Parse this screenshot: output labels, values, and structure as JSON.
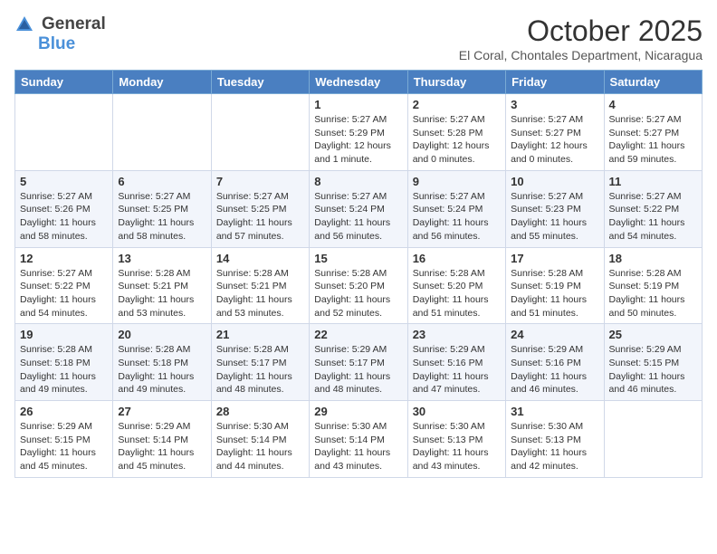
{
  "header": {
    "logo_general": "General",
    "logo_blue": "Blue",
    "month_year": "October 2025",
    "location": "El Coral, Chontales Department, Nicaragua"
  },
  "weekdays": [
    "Sunday",
    "Monday",
    "Tuesday",
    "Wednesday",
    "Thursday",
    "Friday",
    "Saturday"
  ],
  "weeks": [
    [
      {
        "day": "",
        "info": ""
      },
      {
        "day": "",
        "info": ""
      },
      {
        "day": "",
        "info": ""
      },
      {
        "day": "1",
        "info": "Sunrise: 5:27 AM\nSunset: 5:29 PM\nDaylight: 12 hours\nand 1 minute."
      },
      {
        "day": "2",
        "info": "Sunrise: 5:27 AM\nSunset: 5:28 PM\nDaylight: 12 hours\nand 0 minutes."
      },
      {
        "day": "3",
        "info": "Sunrise: 5:27 AM\nSunset: 5:27 PM\nDaylight: 12 hours\nand 0 minutes."
      },
      {
        "day": "4",
        "info": "Sunrise: 5:27 AM\nSunset: 5:27 PM\nDaylight: 11 hours\nand 59 minutes."
      }
    ],
    [
      {
        "day": "5",
        "info": "Sunrise: 5:27 AM\nSunset: 5:26 PM\nDaylight: 11 hours\nand 58 minutes."
      },
      {
        "day": "6",
        "info": "Sunrise: 5:27 AM\nSunset: 5:25 PM\nDaylight: 11 hours\nand 58 minutes."
      },
      {
        "day": "7",
        "info": "Sunrise: 5:27 AM\nSunset: 5:25 PM\nDaylight: 11 hours\nand 57 minutes."
      },
      {
        "day": "8",
        "info": "Sunrise: 5:27 AM\nSunset: 5:24 PM\nDaylight: 11 hours\nand 56 minutes."
      },
      {
        "day": "9",
        "info": "Sunrise: 5:27 AM\nSunset: 5:24 PM\nDaylight: 11 hours\nand 56 minutes."
      },
      {
        "day": "10",
        "info": "Sunrise: 5:27 AM\nSunset: 5:23 PM\nDaylight: 11 hours\nand 55 minutes."
      },
      {
        "day": "11",
        "info": "Sunrise: 5:27 AM\nSunset: 5:22 PM\nDaylight: 11 hours\nand 54 minutes."
      }
    ],
    [
      {
        "day": "12",
        "info": "Sunrise: 5:27 AM\nSunset: 5:22 PM\nDaylight: 11 hours\nand 54 minutes."
      },
      {
        "day": "13",
        "info": "Sunrise: 5:28 AM\nSunset: 5:21 PM\nDaylight: 11 hours\nand 53 minutes."
      },
      {
        "day": "14",
        "info": "Sunrise: 5:28 AM\nSunset: 5:21 PM\nDaylight: 11 hours\nand 53 minutes."
      },
      {
        "day": "15",
        "info": "Sunrise: 5:28 AM\nSunset: 5:20 PM\nDaylight: 11 hours\nand 52 minutes."
      },
      {
        "day": "16",
        "info": "Sunrise: 5:28 AM\nSunset: 5:20 PM\nDaylight: 11 hours\nand 51 minutes."
      },
      {
        "day": "17",
        "info": "Sunrise: 5:28 AM\nSunset: 5:19 PM\nDaylight: 11 hours\nand 51 minutes."
      },
      {
        "day": "18",
        "info": "Sunrise: 5:28 AM\nSunset: 5:19 PM\nDaylight: 11 hours\nand 50 minutes."
      }
    ],
    [
      {
        "day": "19",
        "info": "Sunrise: 5:28 AM\nSunset: 5:18 PM\nDaylight: 11 hours\nand 49 minutes."
      },
      {
        "day": "20",
        "info": "Sunrise: 5:28 AM\nSunset: 5:18 PM\nDaylight: 11 hours\nand 49 minutes."
      },
      {
        "day": "21",
        "info": "Sunrise: 5:28 AM\nSunset: 5:17 PM\nDaylight: 11 hours\nand 48 minutes."
      },
      {
        "day": "22",
        "info": "Sunrise: 5:29 AM\nSunset: 5:17 PM\nDaylight: 11 hours\nand 48 minutes."
      },
      {
        "day": "23",
        "info": "Sunrise: 5:29 AM\nSunset: 5:16 PM\nDaylight: 11 hours\nand 47 minutes."
      },
      {
        "day": "24",
        "info": "Sunrise: 5:29 AM\nSunset: 5:16 PM\nDaylight: 11 hours\nand 46 minutes."
      },
      {
        "day": "25",
        "info": "Sunrise: 5:29 AM\nSunset: 5:15 PM\nDaylight: 11 hours\nand 46 minutes."
      }
    ],
    [
      {
        "day": "26",
        "info": "Sunrise: 5:29 AM\nSunset: 5:15 PM\nDaylight: 11 hours\nand 45 minutes."
      },
      {
        "day": "27",
        "info": "Sunrise: 5:29 AM\nSunset: 5:14 PM\nDaylight: 11 hours\nand 45 minutes."
      },
      {
        "day": "28",
        "info": "Sunrise: 5:30 AM\nSunset: 5:14 PM\nDaylight: 11 hours\nand 44 minutes."
      },
      {
        "day": "29",
        "info": "Sunrise: 5:30 AM\nSunset: 5:14 PM\nDaylight: 11 hours\nand 43 minutes."
      },
      {
        "day": "30",
        "info": "Sunrise: 5:30 AM\nSunset: 5:13 PM\nDaylight: 11 hours\nand 43 minutes."
      },
      {
        "day": "31",
        "info": "Sunrise: 5:30 AM\nSunset: 5:13 PM\nDaylight: 11 hours\nand 42 minutes."
      },
      {
        "day": "",
        "info": ""
      }
    ]
  ]
}
